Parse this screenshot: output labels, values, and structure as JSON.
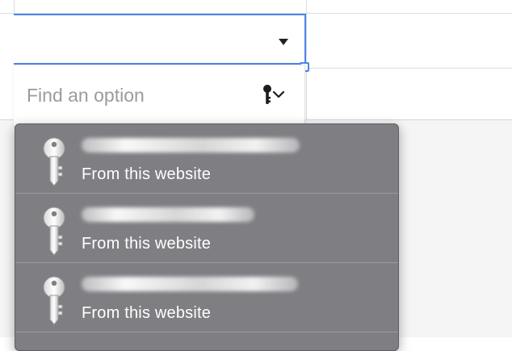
{
  "search": {
    "placeholder": "Find an option",
    "value": ""
  },
  "icons": {
    "search_trigger": "key-chevron-icon",
    "item_icon": "key-icon",
    "select_caret": "triangle-down-icon"
  },
  "colors": {
    "focus_border": "#4a86e8",
    "popup_background": "#7f7e83",
    "popup_text": "#ffffff",
    "placeholder_text": "#9b9b9b"
  },
  "autofill": {
    "items": [
      {
        "username": "[redacted]",
        "origin": "From this website"
      },
      {
        "username": "[redacted]",
        "origin": "From this website"
      },
      {
        "username": "[redacted]",
        "origin": "From this website"
      }
    ]
  }
}
